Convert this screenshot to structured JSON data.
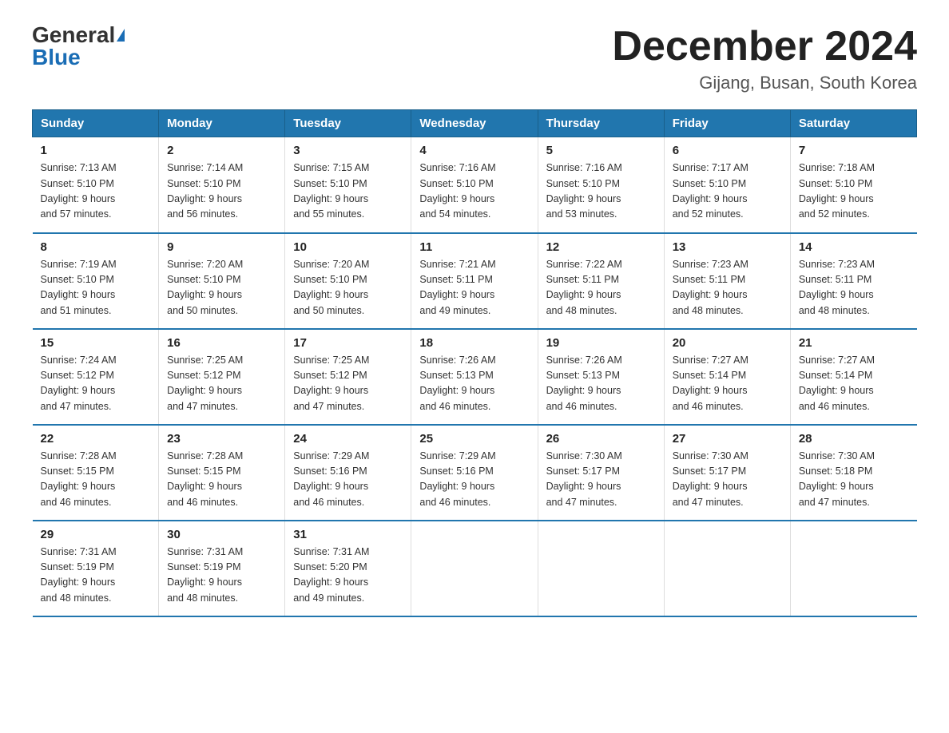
{
  "header": {
    "logo_general": "General",
    "logo_blue": "Blue",
    "title": "December 2024",
    "location": "Gijang, Busan, South Korea"
  },
  "days_of_week": [
    "Sunday",
    "Monday",
    "Tuesday",
    "Wednesday",
    "Thursday",
    "Friday",
    "Saturday"
  ],
  "weeks": [
    [
      {
        "day": "1",
        "sunrise": "7:13 AM",
        "sunset": "5:10 PM",
        "daylight": "9 hours and 57 minutes."
      },
      {
        "day": "2",
        "sunrise": "7:14 AM",
        "sunset": "5:10 PM",
        "daylight": "9 hours and 56 minutes."
      },
      {
        "day": "3",
        "sunrise": "7:15 AM",
        "sunset": "5:10 PM",
        "daylight": "9 hours and 55 minutes."
      },
      {
        "day": "4",
        "sunrise": "7:16 AM",
        "sunset": "5:10 PM",
        "daylight": "9 hours and 54 minutes."
      },
      {
        "day": "5",
        "sunrise": "7:16 AM",
        "sunset": "5:10 PM",
        "daylight": "9 hours and 53 minutes."
      },
      {
        "day": "6",
        "sunrise": "7:17 AM",
        "sunset": "5:10 PM",
        "daylight": "9 hours and 52 minutes."
      },
      {
        "day": "7",
        "sunrise": "7:18 AM",
        "sunset": "5:10 PM",
        "daylight": "9 hours and 52 minutes."
      }
    ],
    [
      {
        "day": "8",
        "sunrise": "7:19 AM",
        "sunset": "5:10 PM",
        "daylight": "9 hours and 51 minutes."
      },
      {
        "day": "9",
        "sunrise": "7:20 AM",
        "sunset": "5:10 PM",
        "daylight": "9 hours and 50 minutes."
      },
      {
        "day": "10",
        "sunrise": "7:20 AM",
        "sunset": "5:10 PM",
        "daylight": "9 hours and 50 minutes."
      },
      {
        "day": "11",
        "sunrise": "7:21 AM",
        "sunset": "5:11 PM",
        "daylight": "9 hours and 49 minutes."
      },
      {
        "day": "12",
        "sunrise": "7:22 AM",
        "sunset": "5:11 PM",
        "daylight": "9 hours and 48 minutes."
      },
      {
        "day": "13",
        "sunrise": "7:23 AM",
        "sunset": "5:11 PM",
        "daylight": "9 hours and 48 minutes."
      },
      {
        "day": "14",
        "sunrise": "7:23 AM",
        "sunset": "5:11 PM",
        "daylight": "9 hours and 48 minutes."
      }
    ],
    [
      {
        "day": "15",
        "sunrise": "7:24 AM",
        "sunset": "5:12 PM",
        "daylight": "9 hours and 47 minutes."
      },
      {
        "day": "16",
        "sunrise": "7:25 AM",
        "sunset": "5:12 PM",
        "daylight": "9 hours and 47 minutes."
      },
      {
        "day": "17",
        "sunrise": "7:25 AM",
        "sunset": "5:12 PM",
        "daylight": "9 hours and 47 minutes."
      },
      {
        "day": "18",
        "sunrise": "7:26 AM",
        "sunset": "5:13 PM",
        "daylight": "9 hours and 46 minutes."
      },
      {
        "day": "19",
        "sunrise": "7:26 AM",
        "sunset": "5:13 PM",
        "daylight": "9 hours and 46 minutes."
      },
      {
        "day": "20",
        "sunrise": "7:27 AM",
        "sunset": "5:14 PM",
        "daylight": "9 hours and 46 minutes."
      },
      {
        "day": "21",
        "sunrise": "7:27 AM",
        "sunset": "5:14 PM",
        "daylight": "9 hours and 46 minutes."
      }
    ],
    [
      {
        "day": "22",
        "sunrise": "7:28 AM",
        "sunset": "5:15 PM",
        "daylight": "9 hours and 46 minutes."
      },
      {
        "day": "23",
        "sunrise": "7:28 AM",
        "sunset": "5:15 PM",
        "daylight": "9 hours and 46 minutes."
      },
      {
        "day": "24",
        "sunrise": "7:29 AM",
        "sunset": "5:16 PM",
        "daylight": "9 hours and 46 minutes."
      },
      {
        "day": "25",
        "sunrise": "7:29 AM",
        "sunset": "5:16 PM",
        "daylight": "9 hours and 46 minutes."
      },
      {
        "day": "26",
        "sunrise": "7:30 AM",
        "sunset": "5:17 PM",
        "daylight": "9 hours and 47 minutes."
      },
      {
        "day": "27",
        "sunrise": "7:30 AM",
        "sunset": "5:17 PM",
        "daylight": "9 hours and 47 minutes."
      },
      {
        "day": "28",
        "sunrise": "7:30 AM",
        "sunset": "5:18 PM",
        "daylight": "9 hours and 47 minutes."
      }
    ],
    [
      {
        "day": "29",
        "sunrise": "7:31 AM",
        "sunset": "5:19 PM",
        "daylight": "9 hours and 48 minutes."
      },
      {
        "day": "30",
        "sunrise": "7:31 AM",
        "sunset": "5:19 PM",
        "daylight": "9 hours and 48 minutes."
      },
      {
        "day": "31",
        "sunrise": "7:31 AM",
        "sunset": "5:20 PM",
        "daylight": "9 hours and 49 minutes."
      },
      null,
      null,
      null,
      null
    ]
  ],
  "labels": {
    "sunrise_prefix": "Sunrise: ",
    "sunset_prefix": "Sunset: ",
    "daylight_prefix": "Daylight: "
  }
}
